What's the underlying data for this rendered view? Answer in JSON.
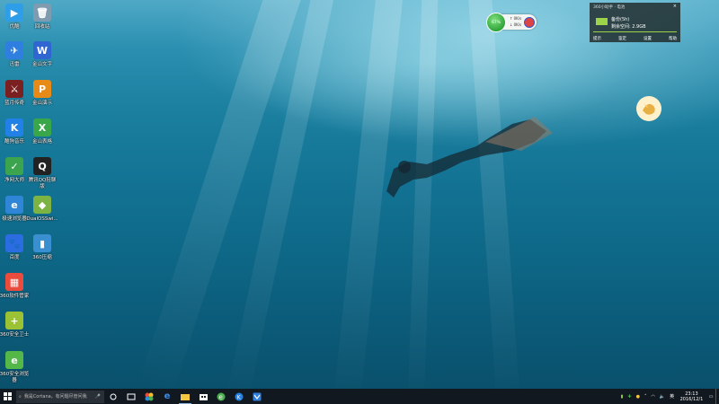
{
  "desktop": {
    "icons": [
      {
        "name": "优酷",
        "glyph": "▶",
        "color": "#2f9ee8"
      },
      {
        "name": "回收站",
        "glyph": "🗑",
        "color": "#7f9bb0"
      },
      {
        "name": "迅雷",
        "glyph": "✈",
        "color": "#2f7fe0"
      },
      {
        "name": "金山文字",
        "glyph": "W",
        "color": "#2f66d1"
      },
      {
        "name": "蓝月传奇",
        "glyph": "⚔",
        "color": "#7a2020"
      },
      {
        "name": "金山演示",
        "glyph": "P",
        "color": "#e88a18"
      },
      {
        "name": "酷狗音乐",
        "glyph": "K",
        "color": "#2181e6"
      },
      {
        "name": "金山表格",
        "glyph": "X",
        "color": "#3aa64a"
      },
      {
        "name": "净网大师",
        "glyph": "✓",
        "color": "#3ca44f"
      },
      {
        "name": "腾讯QQ轻聊版",
        "glyph": "Q",
        "color": "#222"
      },
      {
        "name": "极速浏览器",
        "glyph": "e",
        "color": "#2f86d7"
      },
      {
        "name": "DualOSSwi...",
        "glyph": "◆",
        "color": "#7cb342"
      },
      {
        "name": "百度",
        "glyph": "🐾",
        "color": "#2b6de0"
      },
      {
        "name": "360压缩",
        "glyph": "▮",
        "color": "#3a8fd0"
      },
      {
        "name": "360软件管家",
        "glyph": "▦",
        "color": "#e94b3c"
      },
      {
        "name": "360安全卫士",
        "glyph": "+",
        "color": "#9bc134"
      },
      {
        "name": "360安全浏览器",
        "glyph": "e",
        "color": "#53b848"
      }
    ]
  },
  "speed_widget": {
    "percent": "67%",
    "up": "0K/s",
    "down": "0K/s"
  },
  "battery_panel": {
    "title": "360小助手 · 电池",
    "status": "备份(5h)",
    "remaining": "剩余空间: 2.9GB",
    "buttons": [
      "提示",
      "鉴定",
      "设置",
      "帮助"
    ]
  },
  "taskbar": {
    "search_placeholder": "我是Cortana，有问题尽管问我",
    "lang": "英",
    "time": "23:13",
    "date": "2016/12/1"
  },
  "colors": {
    "taskbar": "#111820",
    "water_top": "#4fa9c6",
    "water_bottom": "#094e69"
  }
}
